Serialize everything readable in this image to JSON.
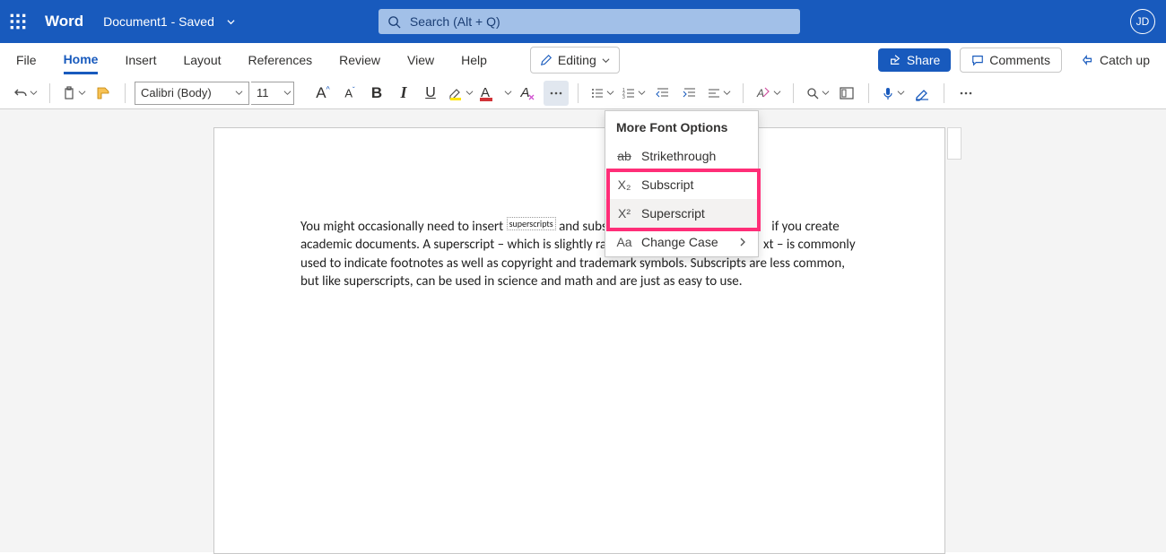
{
  "title_bar": {
    "app_name": "Word",
    "doc_name": "Document1  -  Saved",
    "search_placeholder": "Search (Alt + Q)",
    "user_initials": "JD"
  },
  "menu": {
    "tabs": [
      "File",
      "Home",
      "Insert",
      "Layout",
      "References",
      "Review",
      "View",
      "Help"
    ],
    "active_index": 1,
    "editing_label": "Editing",
    "share_label": "Share",
    "comments_label": "Comments",
    "catchup_label": "Catch up"
  },
  "ribbon": {
    "font_name": "Calibri (Body)",
    "font_size": "11"
  },
  "dropdown": {
    "header": "More Font Options",
    "items": [
      {
        "icon": "ab",
        "label": "Strikethrough",
        "strike": true
      },
      {
        "icon": "X₂",
        "label": "Subscript"
      },
      {
        "icon": "X²",
        "label": "Superscript"
      },
      {
        "icon": "Aa",
        "label": "Change Case",
        "submenu": true
      }
    ],
    "hovered_index": 2
  },
  "document": {
    "line1a": "You might occasionally need to insert ",
    "super_word": "superscripts",
    "line1b": " and subs",
    "line2a": "if you create academic documents. A superscript – which is slightly rai",
    "line2b": "xt – is commonly used to indicate footnotes as well as copyright and trademark symbols. Subscripts are less common, but like superscripts, can be used in science and math and are just as easy to use."
  }
}
